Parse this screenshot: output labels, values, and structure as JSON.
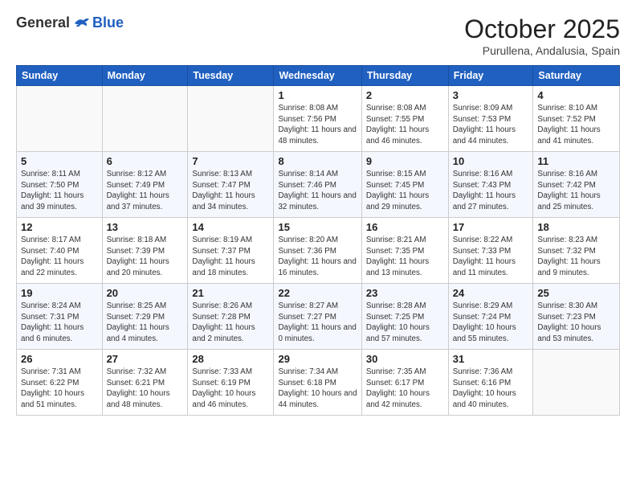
{
  "logo": {
    "general": "General",
    "blue": "Blue"
  },
  "header": {
    "title": "October 2025",
    "location": "Purullena, Andalusia, Spain"
  },
  "days_of_week": [
    "Sunday",
    "Monday",
    "Tuesday",
    "Wednesday",
    "Thursday",
    "Friday",
    "Saturday"
  ],
  "weeks": [
    [
      {
        "day": "",
        "info": ""
      },
      {
        "day": "",
        "info": ""
      },
      {
        "day": "",
        "info": ""
      },
      {
        "day": "1",
        "info": "Sunrise: 8:08 AM\nSunset: 7:56 PM\nDaylight: 11 hours\nand 48 minutes."
      },
      {
        "day": "2",
        "info": "Sunrise: 8:08 AM\nSunset: 7:55 PM\nDaylight: 11 hours\nand 46 minutes."
      },
      {
        "day": "3",
        "info": "Sunrise: 8:09 AM\nSunset: 7:53 PM\nDaylight: 11 hours\nand 44 minutes."
      },
      {
        "day": "4",
        "info": "Sunrise: 8:10 AM\nSunset: 7:52 PM\nDaylight: 11 hours\nand 41 minutes."
      }
    ],
    [
      {
        "day": "5",
        "info": "Sunrise: 8:11 AM\nSunset: 7:50 PM\nDaylight: 11 hours\nand 39 minutes."
      },
      {
        "day": "6",
        "info": "Sunrise: 8:12 AM\nSunset: 7:49 PM\nDaylight: 11 hours\nand 37 minutes."
      },
      {
        "day": "7",
        "info": "Sunrise: 8:13 AM\nSunset: 7:47 PM\nDaylight: 11 hours\nand 34 minutes."
      },
      {
        "day": "8",
        "info": "Sunrise: 8:14 AM\nSunset: 7:46 PM\nDaylight: 11 hours\nand 32 minutes."
      },
      {
        "day": "9",
        "info": "Sunrise: 8:15 AM\nSunset: 7:45 PM\nDaylight: 11 hours\nand 29 minutes."
      },
      {
        "day": "10",
        "info": "Sunrise: 8:16 AM\nSunset: 7:43 PM\nDaylight: 11 hours\nand 27 minutes."
      },
      {
        "day": "11",
        "info": "Sunrise: 8:16 AM\nSunset: 7:42 PM\nDaylight: 11 hours\nand 25 minutes."
      }
    ],
    [
      {
        "day": "12",
        "info": "Sunrise: 8:17 AM\nSunset: 7:40 PM\nDaylight: 11 hours\nand 22 minutes."
      },
      {
        "day": "13",
        "info": "Sunrise: 8:18 AM\nSunset: 7:39 PM\nDaylight: 11 hours\nand 20 minutes."
      },
      {
        "day": "14",
        "info": "Sunrise: 8:19 AM\nSunset: 7:37 PM\nDaylight: 11 hours\nand 18 minutes."
      },
      {
        "day": "15",
        "info": "Sunrise: 8:20 AM\nSunset: 7:36 PM\nDaylight: 11 hours\nand 16 minutes."
      },
      {
        "day": "16",
        "info": "Sunrise: 8:21 AM\nSunset: 7:35 PM\nDaylight: 11 hours\nand 13 minutes."
      },
      {
        "day": "17",
        "info": "Sunrise: 8:22 AM\nSunset: 7:33 PM\nDaylight: 11 hours\nand 11 minutes."
      },
      {
        "day": "18",
        "info": "Sunrise: 8:23 AM\nSunset: 7:32 PM\nDaylight: 11 hours\nand 9 minutes."
      }
    ],
    [
      {
        "day": "19",
        "info": "Sunrise: 8:24 AM\nSunset: 7:31 PM\nDaylight: 11 hours\nand 6 minutes."
      },
      {
        "day": "20",
        "info": "Sunrise: 8:25 AM\nSunset: 7:29 PM\nDaylight: 11 hours\nand 4 minutes."
      },
      {
        "day": "21",
        "info": "Sunrise: 8:26 AM\nSunset: 7:28 PM\nDaylight: 11 hours\nand 2 minutes."
      },
      {
        "day": "22",
        "info": "Sunrise: 8:27 AM\nSunset: 7:27 PM\nDaylight: 11 hours\nand 0 minutes."
      },
      {
        "day": "23",
        "info": "Sunrise: 8:28 AM\nSunset: 7:25 PM\nDaylight: 10 hours\nand 57 minutes."
      },
      {
        "day": "24",
        "info": "Sunrise: 8:29 AM\nSunset: 7:24 PM\nDaylight: 10 hours\nand 55 minutes."
      },
      {
        "day": "25",
        "info": "Sunrise: 8:30 AM\nSunset: 7:23 PM\nDaylight: 10 hours\nand 53 minutes."
      }
    ],
    [
      {
        "day": "26",
        "info": "Sunrise: 7:31 AM\nSunset: 6:22 PM\nDaylight: 10 hours\nand 51 minutes."
      },
      {
        "day": "27",
        "info": "Sunrise: 7:32 AM\nSunset: 6:21 PM\nDaylight: 10 hours\nand 48 minutes."
      },
      {
        "day": "28",
        "info": "Sunrise: 7:33 AM\nSunset: 6:19 PM\nDaylight: 10 hours\nand 46 minutes."
      },
      {
        "day": "29",
        "info": "Sunrise: 7:34 AM\nSunset: 6:18 PM\nDaylight: 10 hours\nand 44 minutes."
      },
      {
        "day": "30",
        "info": "Sunrise: 7:35 AM\nSunset: 6:17 PM\nDaylight: 10 hours\nand 42 minutes."
      },
      {
        "day": "31",
        "info": "Sunrise: 7:36 AM\nSunset: 6:16 PM\nDaylight: 10 hours\nand 40 minutes."
      },
      {
        "day": "",
        "info": ""
      }
    ]
  ]
}
